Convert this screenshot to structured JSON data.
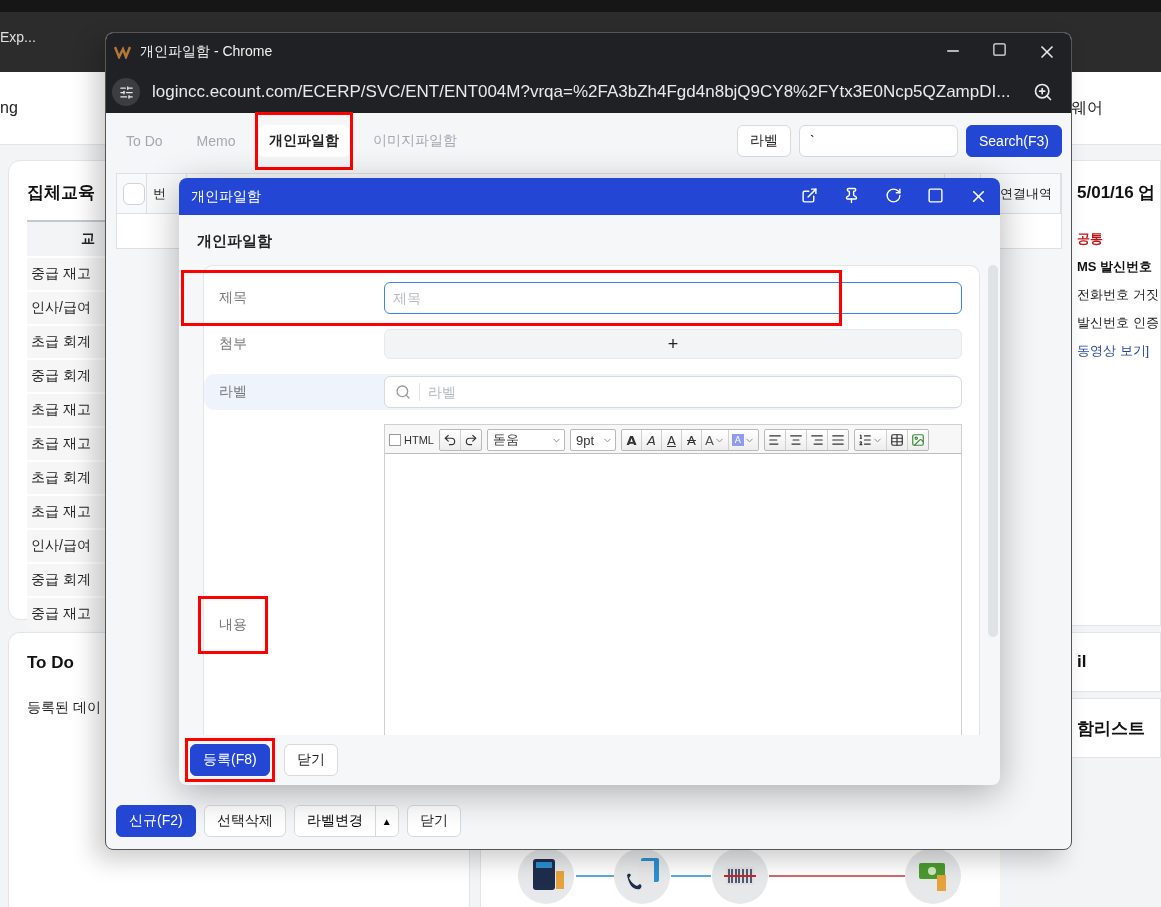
{
  "browser": {
    "bookmark": "Exp...",
    "page_left": "ng",
    "page_right": "웨어"
  },
  "background": {
    "education_card": {
      "title": "집체교육",
      "column_1": "교",
      "rows": [
        "중급 재고",
        "인사/급여",
        "초급 회계",
        "중급 회계",
        "초급 재고",
        "초급 재고",
        "초급 회계",
        "초급 재고",
        "인사/급여",
        "중급 회계",
        "중급 재고"
      ]
    },
    "todo_card": {
      "title": "To Do",
      "message": "등록된 데이"
    },
    "notice_card": {
      "title": "5/01/16 업",
      "lines": [
        {
          "kind": "category",
          "text": "공통"
        },
        {
          "kind": "heading",
          "text": "MS 발신번호"
        },
        {
          "kind": "body",
          "text": "전화번호 거짓"
        },
        {
          "kind": "body",
          "text": "발신번호 인증"
        },
        {
          "kind": "link",
          "text": "동영상 보기]"
        }
      ]
    },
    "side_cards": [
      "il",
      "함리스트"
    ]
  },
  "popup": {
    "title": "개인파일함 - Chrome",
    "url": "logincc.ecount.com/ECERP/SVC/ENT/ENT004M?vrqa=%2FA3bZh4Fgd4n8bjQ9CY8%2FYtx3E0Ncp5QZampDI...",
    "tabs": [
      {
        "label": "To Do",
        "selected": false,
        "highlighted": false
      },
      {
        "label": "Memo",
        "selected": false,
        "highlighted": false
      },
      {
        "label": "개인파일함",
        "selected": true,
        "highlighted": true
      },
      {
        "label": "이미지파일함",
        "selected": false,
        "highlighted": false
      }
    ],
    "label_button": "라벨",
    "search_value": "`",
    "search_button": "Search(F3)",
    "table": {
      "select_all_checked": false,
      "columns": [
        "번",
        "연결내역"
      ]
    },
    "footer": [
      {
        "kind": "primary",
        "label": "신규(F2)"
      },
      {
        "kind": "default",
        "label": "선택삭제"
      },
      {
        "kind": "split",
        "label": "라벨변경",
        "caret": "▲"
      },
      {
        "kind": "default",
        "label": "닫기"
      }
    ]
  },
  "dialog": {
    "title": "개인파일함",
    "heading": "개인파일함",
    "fields": [
      {
        "kind": "text",
        "label": "제목",
        "placeholder": "제목",
        "focused": true,
        "highlighted": true
      },
      {
        "kind": "attach",
        "label": "첨부",
        "button": "+",
        "highlighted": false
      },
      {
        "kind": "search",
        "label": "라벨",
        "placeholder": "라벨",
        "highlighted": false
      },
      {
        "kind": "editor",
        "label": "내용",
        "highlighted": true
      }
    ],
    "editor": {
      "html_label": "HTML",
      "html_checked": false,
      "font": "돋움",
      "size": "9pt",
      "format_buttons": [
        {
          "kind": "bold",
          "label": "A"
        },
        {
          "kind": "italic",
          "label": "A"
        },
        {
          "kind": "underline",
          "label": "A"
        },
        {
          "kind": "strike",
          "label": "A"
        },
        {
          "kind": "color",
          "label": "A"
        },
        {
          "kind": "highlight",
          "label": "A"
        }
      ]
    },
    "footer": [
      {
        "kind": "primary",
        "label": "등록(F8)",
        "highlighted": true
      },
      {
        "kind": "default",
        "label": "닫기",
        "highlighted": false
      }
    ]
  }
}
